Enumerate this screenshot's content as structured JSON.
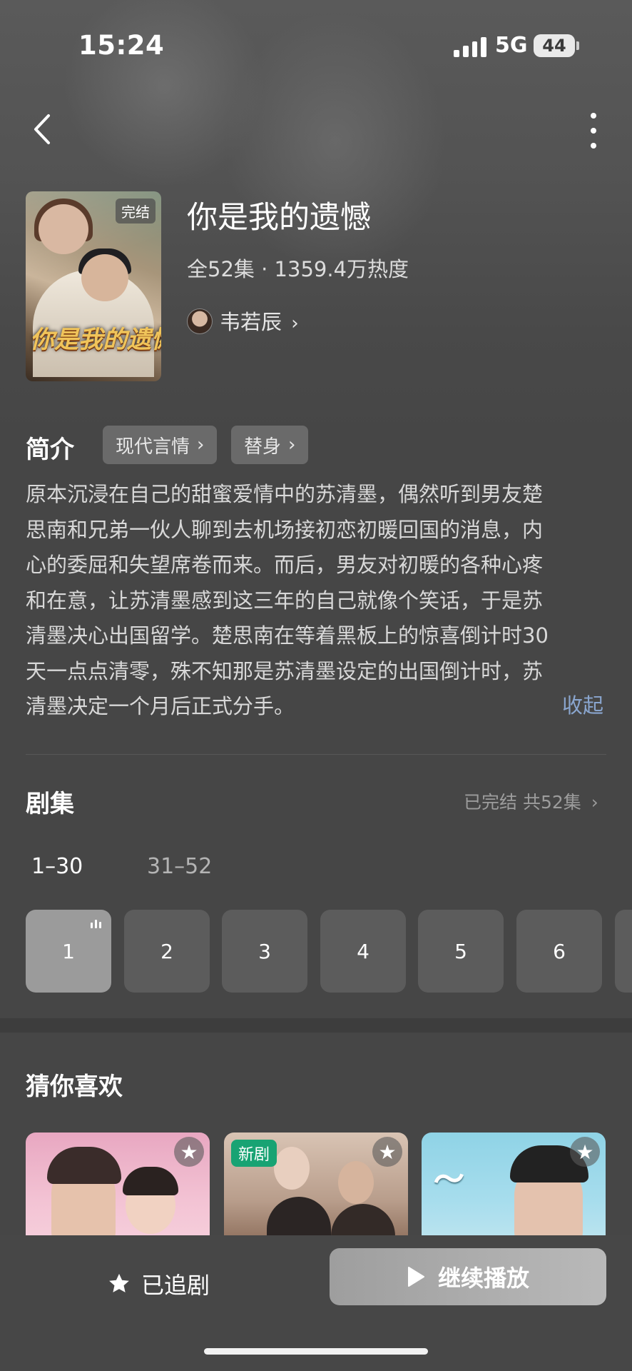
{
  "status": {
    "time": "15:24",
    "network": "5G",
    "battery": "44"
  },
  "drama": {
    "title": "你是我的遗憾",
    "meta": "全52集 · 1359.4万热度",
    "author": "韦若辰",
    "poster_badge": "完结",
    "poster_title": "你是我的遗憾"
  },
  "intro": {
    "heading": "简介",
    "tags": [
      "现代言情",
      "替身"
    ],
    "lines": [
      "原本沉浸在自己的甜蜜爱情中的苏清墨，偶然听到男友楚",
      "思南和兄弟一伙人聊到去机场接初恋初暖回国的消息，内",
      "心的委屈和失望席卷而来。而后，男友对初暖的各种心疼",
      "和在意，让苏清墨感到这三年的自己就像个笑话，于是苏",
      "清墨决心出国留学。楚思南在等着黑板上的惊喜倒计时30",
      "天一点点清零，殊不知那是苏清墨设定的出国倒计时，苏",
      "清墨决定一个月后正式分手。"
    ],
    "collapse": "收起"
  },
  "episodes": {
    "heading": "剧集",
    "status": "已完结 共52集",
    "ranges": [
      "1–30",
      "31–52"
    ],
    "items": [
      "1",
      "2",
      "3",
      "4",
      "5",
      "6"
    ],
    "current": "1"
  },
  "recommend": {
    "heading": "猜你喜欢",
    "new_badge": "新剧",
    "star": "★"
  },
  "actions": {
    "follow": "已追剧",
    "play": "继续播放"
  }
}
